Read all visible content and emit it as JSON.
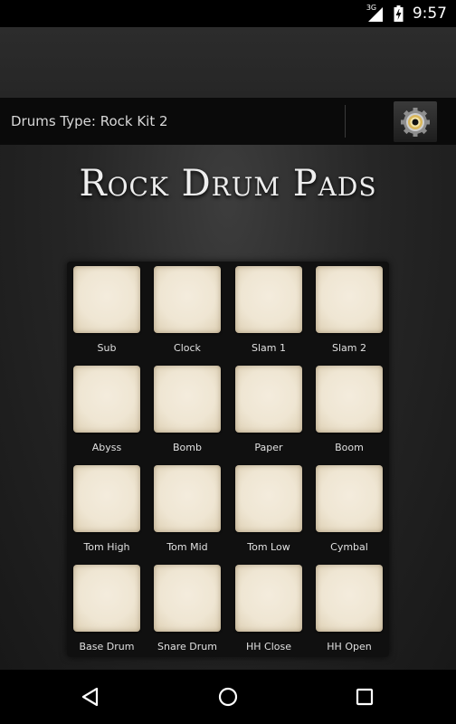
{
  "status_bar": {
    "network": "3G",
    "time": "9:57"
  },
  "drums_type": {
    "label": "Drums Type: Rock Kit 2"
  },
  "header": {
    "title": "Rock Drum Pads"
  },
  "pads": [
    {
      "label": "Sub"
    },
    {
      "label": "Clock"
    },
    {
      "label": "Slam 1"
    },
    {
      "label": "Slam 2"
    },
    {
      "label": "Abyss"
    },
    {
      "label": "Bomb"
    },
    {
      "label": "Paper"
    },
    {
      "label": "Boom"
    },
    {
      "label": "Tom High"
    },
    {
      "label": "Tom Mid"
    },
    {
      "label": "Tom Low"
    },
    {
      "label": "Cymbal"
    },
    {
      "label": "Base Drum"
    },
    {
      "label": "Snare Drum"
    },
    {
      "label": "HH Close"
    },
    {
      "label": "HH Open"
    }
  ],
  "nav": {
    "back_icon": "back-triangle-icon",
    "home_icon": "home-circle-icon",
    "recents_icon": "recents-square-icon"
  },
  "colors": {
    "pad": "#efe6d3",
    "panel": "#101010",
    "gear_gold": "#d9b65a"
  }
}
